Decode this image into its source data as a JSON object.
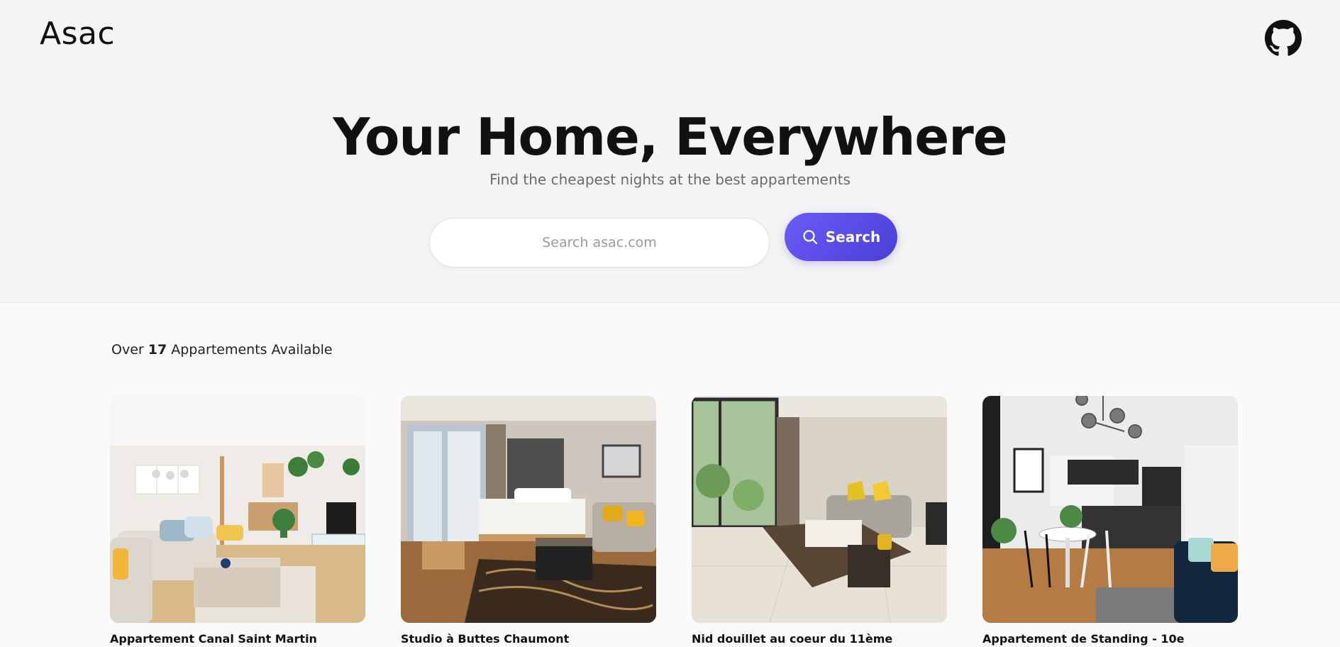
{
  "brand": {
    "name": "Asac"
  },
  "hero": {
    "title": "Your Home, Everywhere",
    "subtitle": "Find the cheapest nights at the best appartements"
  },
  "search": {
    "placeholder": "Search asac.com",
    "button_label": "Search"
  },
  "listing": {
    "prefix": "Over",
    "count": "17",
    "suffix": "Appartements Available",
    "cards": [
      {
        "name": "Appartement Canal Saint Martin",
        "image": "living-room-photo"
      },
      {
        "name": "Studio à Buttes Chaumont",
        "image": "bedroom-studio-photo"
      },
      {
        "name": "Nid douillet au coeur du 11ème",
        "image": "sitting-room-photo"
      },
      {
        "name": "Appartement de Standing - 10e",
        "image": "kitchen-dining-photo"
      }
    ]
  },
  "icons": {
    "github": "github-icon",
    "search": "search-icon"
  },
  "colors": {
    "accent": "#5b4fe8",
    "hero_bg": "#f4f4f4",
    "page_bg": "#fafafa"
  }
}
